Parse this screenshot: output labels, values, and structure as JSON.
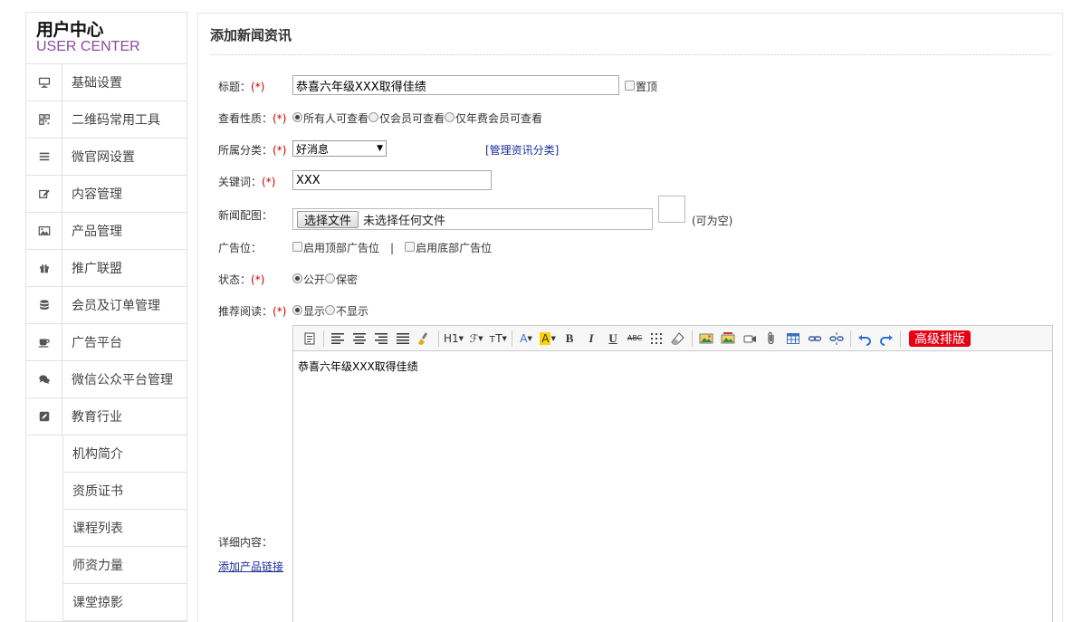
{
  "sidebar": {
    "logo_cn": "用户中心",
    "logo_en": "USER CENTER",
    "items": [
      {
        "label": "基础设置",
        "icon": "monitor-icon"
      },
      {
        "label": "二维码常用工具",
        "icon": "qrcode-icon"
      },
      {
        "label": "微官网设置",
        "icon": "list-icon"
      },
      {
        "label": "内容管理",
        "icon": "edit-icon"
      },
      {
        "label": "产品管理",
        "icon": "picture-icon"
      },
      {
        "label": "推广联盟",
        "icon": "gift-icon"
      },
      {
        "label": "会员及订单管理",
        "icon": "database-icon"
      },
      {
        "label": "广告平台",
        "icon": "coffee-icon"
      },
      {
        "label": "微信公众平台管理",
        "icon": "comments-icon"
      },
      {
        "label": "教育行业",
        "icon": "pencil-square-icon"
      }
    ],
    "sub_items": [
      "机构简介",
      "资质证书",
      "课程列表",
      "师资力量",
      "课堂掠影"
    ]
  },
  "main": {
    "page_title": "添加新闻资讯",
    "req_mark": "(*)",
    "title_label": "标题：",
    "title_value": "恭喜六年级XXX取得佳绩",
    "pin_label": "置顶",
    "visibility_label": "查看性质：",
    "visibility_options": [
      "所有人可查看",
      "仅会员可查看",
      "仅年费会员可查看"
    ],
    "category_label": "所属分类：",
    "category_selected": "好消息",
    "manage_category_link": "[管理资讯分类]",
    "keywords_label": "关键词：",
    "keywords_value": "XXX",
    "image_label": "新闻配图：",
    "file_button": "选择文件",
    "file_none": "未选择任何文件",
    "optional_note": "(可为空)",
    "ad_label": "广告位：",
    "ad_top": "启用顶部广告位",
    "ad_sep": "|",
    "ad_bottom": "启用底部广告位",
    "status_label": "状态：",
    "status_options": [
      "公开",
      "保密"
    ],
    "recommend_label": "推荐阅读：",
    "recommend_options": [
      "显示",
      "不显示"
    ],
    "detail_label": "详细内容：",
    "add_product_link": "添加产品链接",
    "editor_content": "恭喜六年级XXX取得佳绩",
    "toolbar": {
      "h1": "H1",
      "font_family": "ℱ",
      "font_size": "тT",
      "font_color": "A",
      "bg_color": "A",
      "bold": "B",
      "italic": "I",
      "underline": "U",
      "strike": "ABC",
      "advanced_layout": "高级排版"
    }
  }
}
